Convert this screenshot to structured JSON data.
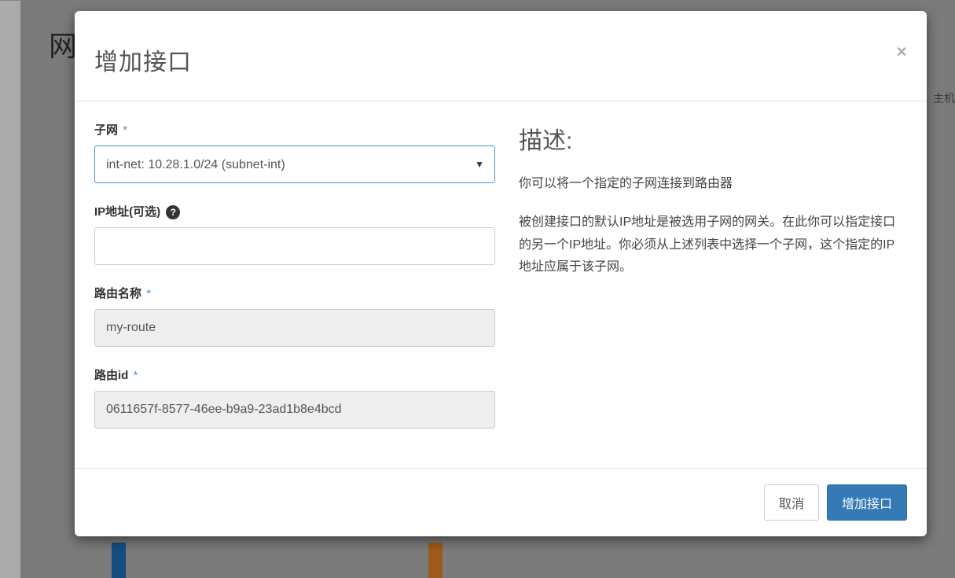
{
  "background": {
    "left_char": "网",
    "right_text": "主机"
  },
  "modal": {
    "title": "增加接口",
    "close_glyph": "×",
    "form": {
      "subnet": {
        "label": "子网",
        "required": "*",
        "selected": "int-net: 10.28.1.0/24 (subnet-int)"
      },
      "ip_address": {
        "label": "IP地址(可选)",
        "help_glyph": "?",
        "value": ""
      },
      "router_name": {
        "label": "路由名称",
        "required": "*",
        "value": "my-route"
      },
      "router_id": {
        "label": "路由id",
        "required": "*",
        "value": "0611657f-8577-46ee-b9a9-23ad1b8e4bcd"
      }
    },
    "description": {
      "title": "描述:",
      "para1": "你可以将一个指定的子网连接到路由器",
      "para2": "被创建接口的默认IP地址是被选用子网的网关。在此你可以指定接口的另一个IP地址。你必须从上述列表中选择一个子网，这个指定的IP地址应属于该子网。"
    },
    "footer": {
      "cancel": "取消",
      "submit": "增加接口"
    }
  }
}
